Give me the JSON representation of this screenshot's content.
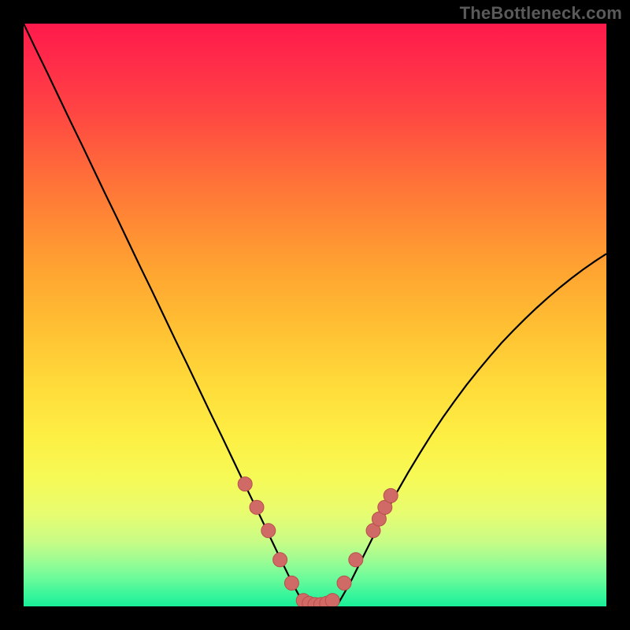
{
  "watermark": "TheBottleneck.com",
  "colors": {
    "frame": "#000000",
    "curve": "#000000",
    "marker_fill": "#cf6a66",
    "marker_stroke": "#b94f4c"
  },
  "chart_data": {
    "type": "line",
    "title": "",
    "xlabel": "",
    "ylabel": "",
    "xlim": [
      0,
      100
    ],
    "ylim": [
      0,
      100
    ],
    "x": [
      0,
      2,
      4,
      6,
      8,
      10,
      12,
      14,
      16,
      18,
      20,
      22,
      24,
      26,
      28,
      30,
      32,
      34,
      36,
      38,
      40,
      42,
      44,
      46,
      48,
      50,
      52,
      54,
      56,
      58,
      60,
      62,
      64,
      66,
      68,
      70,
      72,
      74,
      76,
      78,
      80,
      82,
      84,
      86,
      88,
      90,
      92,
      94,
      96,
      98,
      100
    ],
    "series": [
      {
        "name": "bottleneck-curve",
        "values": [
          100,
          95.8,
          91.7,
          87.5,
          83.3,
          79.2,
          75.0,
          70.8,
          66.7,
          62.5,
          58.3,
          54.2,
          50.0,
          45.8,
          41.7,
          37.5,
          33.3,
          29.2,
          25.0,
          20.8,
          16.7,
          12.5,
          8.3,
          4.2,
          0.5,
          0,
          0,
          0.5,
          4.0,
          8.0,
          12.0,
          15.8,
          19.5,
          23.0,
          26.3,
          29.5,
          32.5,
          35.3,
          38.0,
          40.5,
          42.9,
          45.2,
          47.3,
          49.3,
          51.2,
          53.0,
          54.7,
          56.3,
          57.8,
          59.2,
          60.5
        ]
      }
    ],
    "markers": {
      "name": "highlighted-points",
      "x": [
        38,
        40,
        42,
        44,
        46,
        48,
        49,
        50,
        51,
        52,
        53,
        55,
        57,
        60,
        61,
        62,
        63
      ],
      "y": [
        21,
        17,
        13,
        8,
        4,
        1,
        0.5,
        0.3,
        0.3,
        0.5,
        1,
        4,
        8,
        13,
        15,
        17,
        19
      ]
    }
  }
}
